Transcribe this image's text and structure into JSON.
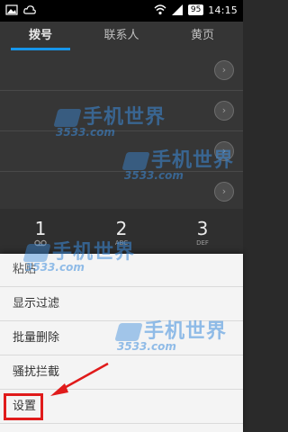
{
  "status_bar": {
    "time": "14:15",
    "battery": "95"
  },
  "tabs": [
    {
      "label": "拨号",
      "active": true
    },
    {
      "label": "联系人",
      "active": false
    },
    {
      "label": "黄页",
      "active": false
    }
  ],
  "dialpad": {
    "keys": [
      {
        "num": "1",
        "letters": ""
      },
      {
        "num": "2",
        "letters": "ABC"
      },
      {
        "num": "3",
        "letters": "DEF"
      }
    ]
  },
  "menu": {
    "items": [
      {
        "label": "粘贴"
      },
      {
        "label": "显示过滤"
      },
      {
        "label": "批量删除"
      },
      {
        "label": "骚扰拦截"
      },
      {
        "label": "设置"
      }
    ]
  },
  "watermark": {
    "text": "手机世界",
    "sub": "3533.com"
  },
  "colors": {
    "accent": "#1aa3ff",
    "highlight": "#e01b1b"
  }
}
